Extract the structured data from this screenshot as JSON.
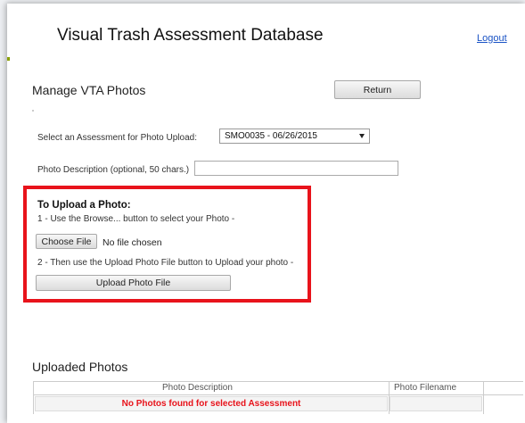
{
  "header": {
    "app_title": "Visual Trash Assessment Database",
    "logout_label": "Logout"
  },
  "manage": {
    "title": "Manage VTA Photos",
    "return_label": "Return"
  },
  "assessment_select": {
    "label": "Select an Assessment for Photo Upload:",
    "selected_value": "SMO0035 - 06/26/2015"
  },
  "photo_description": {
    "label": "Photo Description (optional, 50 chars.)",
    "value": ""
  },
  "upload": {
    "heading": "To Upload a Photo:",
    "step1": "1 - Use the Browse... button to select your Photo -",
    "choose_file_label": "Choose File",
    "no_file_text": "No file chosen",
    "step2": "2 - Then use the Upload Photo File button to Upload your photo -",
    "upload_button_label": "Upload Photo File",
    "highlight_color": "#e8131b"
  },
  "uploaded_photos": {
    "title": "Uploaded Photos",
    "columns": [
      "Photo Description",
      "Photo Filename"
    ],
    "empty_message": "No Photos found for selected Assessment"
  }
}
